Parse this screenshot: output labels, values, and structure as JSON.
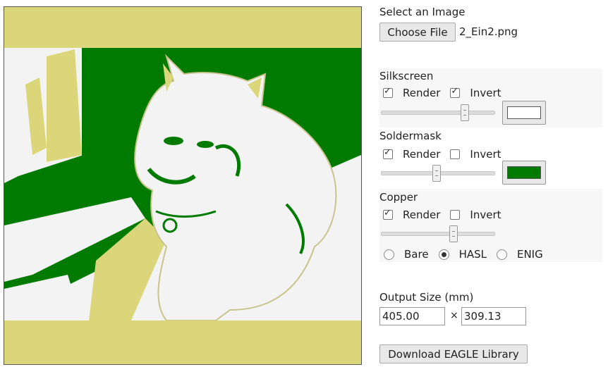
{
  "colors": {
    "silkscreen": "#ffffff",
    "soldermask": "#007a00",
    "copper_bg": "#dbd67a",
    "board_white": "#f3f3f3"
  },
  "file": {
    "heading": "Select an Image",
    "choose_label": "Choose File",
    "file_name": "2_Ein2.png"
  },
  "silkscreen": {
    "title": "Silkscreen",
    "render_label": "Render",
    "render_checked": true,
    "invert_label": "Invert",
    "invert_checked": true,
    "threshold_fraction": 0.72
  },
  "soldermask": {
    "title": "Soldermask",
    "render_label": "Render",
    "render_checked": true,
    "invert_label": "Invert",
    "invert_checked": false,
    "threshold_fraction": 0.47
  },
  "copper": {
    "title": "Copper",
    "render_label": "Render",
    "render_checked": true,
    "invert_label": "Invert",
    "invert_checked": false,
    "threshold_fraction": 0.62,
    "finishes": [
      "Bare",
      "HASL",
      "ENIG"
    ],
    "selected_finish": "HASL"
  },
  "output": {
    "heading": "Output Size (mm)",
    "width": "405.00",
    "times": "×",
    "height": "309.13"
  },
  "download_label": "Download EAGLE Library"
}
